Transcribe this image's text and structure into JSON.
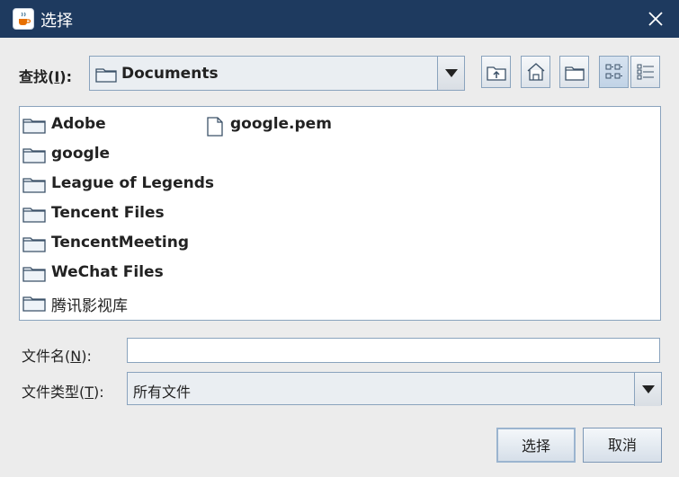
{
  "window": {
    "title": "选择",
    "app_icon": "java-cup-icon",
    "close_icon": "close-icon"
  },
  "lookin": {
    "label_prefix": "查找(",
    "label_mnemonic": "I",
    "label_suffix": "):",
    "value": "Documents"
  },
  "toolbar": {
    "buttons": [
      {
        "name": "up-one-level-button",
        "icon": "folder-up-icon"
      },
      {
        "name": "home-button",
        "icon": "home-icon"
      },
      {
        "name": "new-folder-button",
        "icon": "new-folder-icon"
      },
      {
        "name": "list-view-button",
        "icon": "list-view-icon",
        "active": true
      },
      {
        "name": "details-view-button",
        "icon": "details-view-icon",
        "active": false
      }
    ]
  },
  "files": [
    {
      "label": "Adobe",
      "type": "folder"
    },
    {
      "label": "google",
      "type": "folder"
    },
    {
      "label": "League of Legends",
      "type": "folder"
    },
    {
      "label": "Tencent Files",
      "type": "folder"
    },
    {
      "label": "TencentMeeting",
      "type": "folder"
    },
    {
      "label": "WeChat Files",
      "type": "folder"
    },
    {
      "label": "腾讯影视库",
      "type": "folder"
    },
    {
      "label": "google.pem",
      "type": "file"
    }
  ],
  "filename": {
    "label_prefix": "文件名(",
    "label_mnemonic": "N",
    "label_suffix": "):",
    "value": ""
  },
  "filetype": {
    "label_prefix": "文件类型(",
    "label_mnemonic": "T",
    "label_suffix": "):",
    "value": "所有文件"
  },
  "buttons": {
    "approve": "选择",
    "cancel": "取消"
  },
  "colors": {
    "titlebar": "#1e3a5f",
    "border": "#8aa3bd"
  }
}
